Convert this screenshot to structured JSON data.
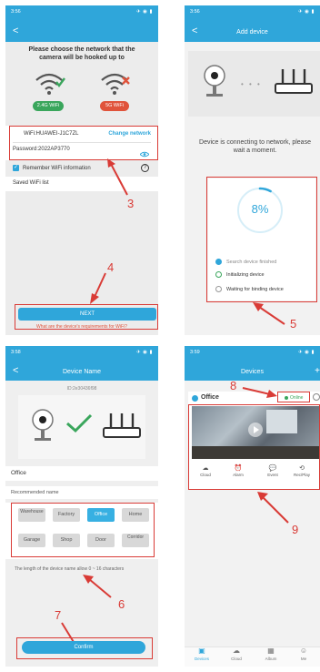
{
  "screen1": {
    "time": "3:56",
    "sys": "✈ ◉ ▮",
    "heading": "Please choose the network that the camera will be hooked up to",
    "wifi_24": "2.4G WiFi",
    "wifi_5": "5G WiFi",
    "wifi_label": "WiFi:",
    "wifi_value": "HUAWEI-J1C7ZL",
    "change_network": "Change network",
    "password_label": "Password:",
    "password_value": "2022AP3770",
    "remember": "Remember WiFi information",
    "help": "?",
    "saved_list": "Saved WiFi list",
    "next": "NEXT",
    "requirements": "What are the device's requirements for WiFi?",
    "anno_3": "3",
    "anno_4": "4"
  },
  "screen2": {
    "time": "3:56",
    "sys": "✈ ◉ ▮",
    "back": "<",
    "title": "Add device",
    "connecting": "Device is connecting to network, please wait a moment.",
    "percent": "8%",
    "progress": 0.08,
    "steps": [
      {
        "label": "Search device finished",
        "state": "done"
      },
      {
        "label": "Initializing device",
        "state": "active"
      },
      {
        "label": "Waiting for binding device",
        "state": "pending"
      }
    ],
    "anno_5": "5"
  },
  "screen3": {
    "time": "3:58",
    "sys": "✈ ◉ ▮",
    "back": "<",
    "title": "Device Name",
    "device_id": "ID:2e30436f98",
    "name_value": "Office",
    "recommended": "Recommended name",
    "chips": [
      {
        "label": "Warehouse",
        "active": false
      },
      {
        "label": "Factory",
        "active": false
      },
      {
        "label": "Office",
        "active": true
      },
      {
        "label": "Home",
        "active": false
      },
      {
        "label": "Garage",
        "active": false
      },
      {
        "label": "Shop",
        "active": false
      },
      {
        "label": "Door",
        "active": false
      },
      {
        "label": "Corridor",
        "active": false
      }
    ],
    "length_hint": "The length of the device name allow 0 ~ 16 characters",
    "confirm": "Confirm",
    "anno_6": "6",
    "anno_7": "7"
  },
  "screen4": {
    "time": "3:59",
    "sys": "✈ ◉ ▮",
    "title": "Devices",
    "device_name": "Office",
    "online": "Online",
    "controls": [
      {
        "icon": "☁",
        "label": "Cloud"
      },
      {
        "icon": "⏰",
        "label": "Alarm"
      },
      {
        "icon": "💬",
        "label": "Event"
      },
      {
        "icon": "⟲",
        "label": "Rec/Play"
      }
    ],
    "tabs": [
      {
        "icon": "▣",
        "label": "Devices",
        "active": true
      },
      {
        "icon": "☁",
        "label": "Cloud",
        "active": false
      },
      {
        "icon": "▦",
        "label": "Album",
        "active": false
      },
      {
        "icon": "☺",
        "label": "Me",
        "active": false
      }
    ],
    "anno_8": "8",
    "anno_9": "9"
  },
  "colors": {
    "primary": "#2fa6da",
    "annotation": "#d93b36",
    "wifi_ok": "#3aa65c",
    "wifi_bad": "#e0533b"
  }
}
